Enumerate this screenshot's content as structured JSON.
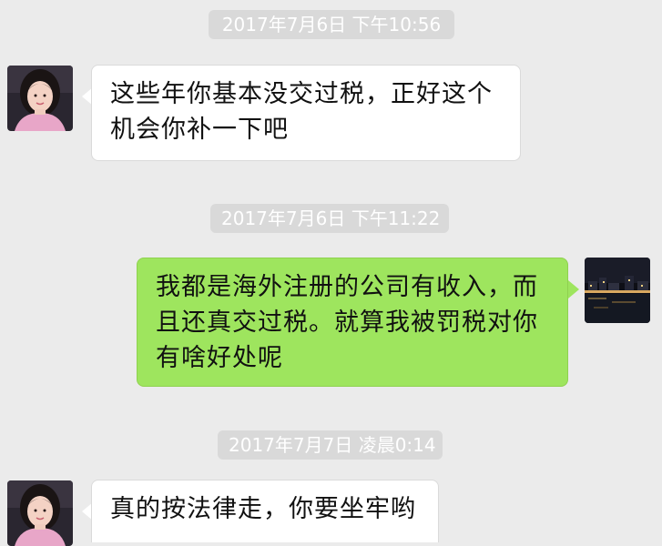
{
  "conversation": {
    "messages": [
      {
        "timestamp": "2017年7月6日 下午10:56",
        "sender": "contact",
        "lines": [
          "这些年你基本没交过税，正好这个",
          "机会你补一下吧"
        ]
      },
      {
        "timestamp": "2017年7月6日 下午11:22",
        "sender": "me",
        "lines": [
          "我都是海外注册的公司有收入，而",
          "且还真交过税。就算我被罚税对你",
          "有啥好处呢"
        ]
      },
      {
        "timestamp": "2017年7月7日 凌晨0:14",
        "sender": "contact",
        "lines": [
          "真的按法律走，你要坐牢哟"
        ]
      }
    ]
  },
  "colors": {
    "background": "#ebebeb",
    "timestamp_bg": "#d9d9d9",
    "bubble_received": "#ffffff",
    "bubble_sent": "#9ee55e"
  },
  "icons": {
    "contact_avatar": "portrait-photo-avatar",
    "my_avatar": "night-city-photo-avatar"
  }
}
